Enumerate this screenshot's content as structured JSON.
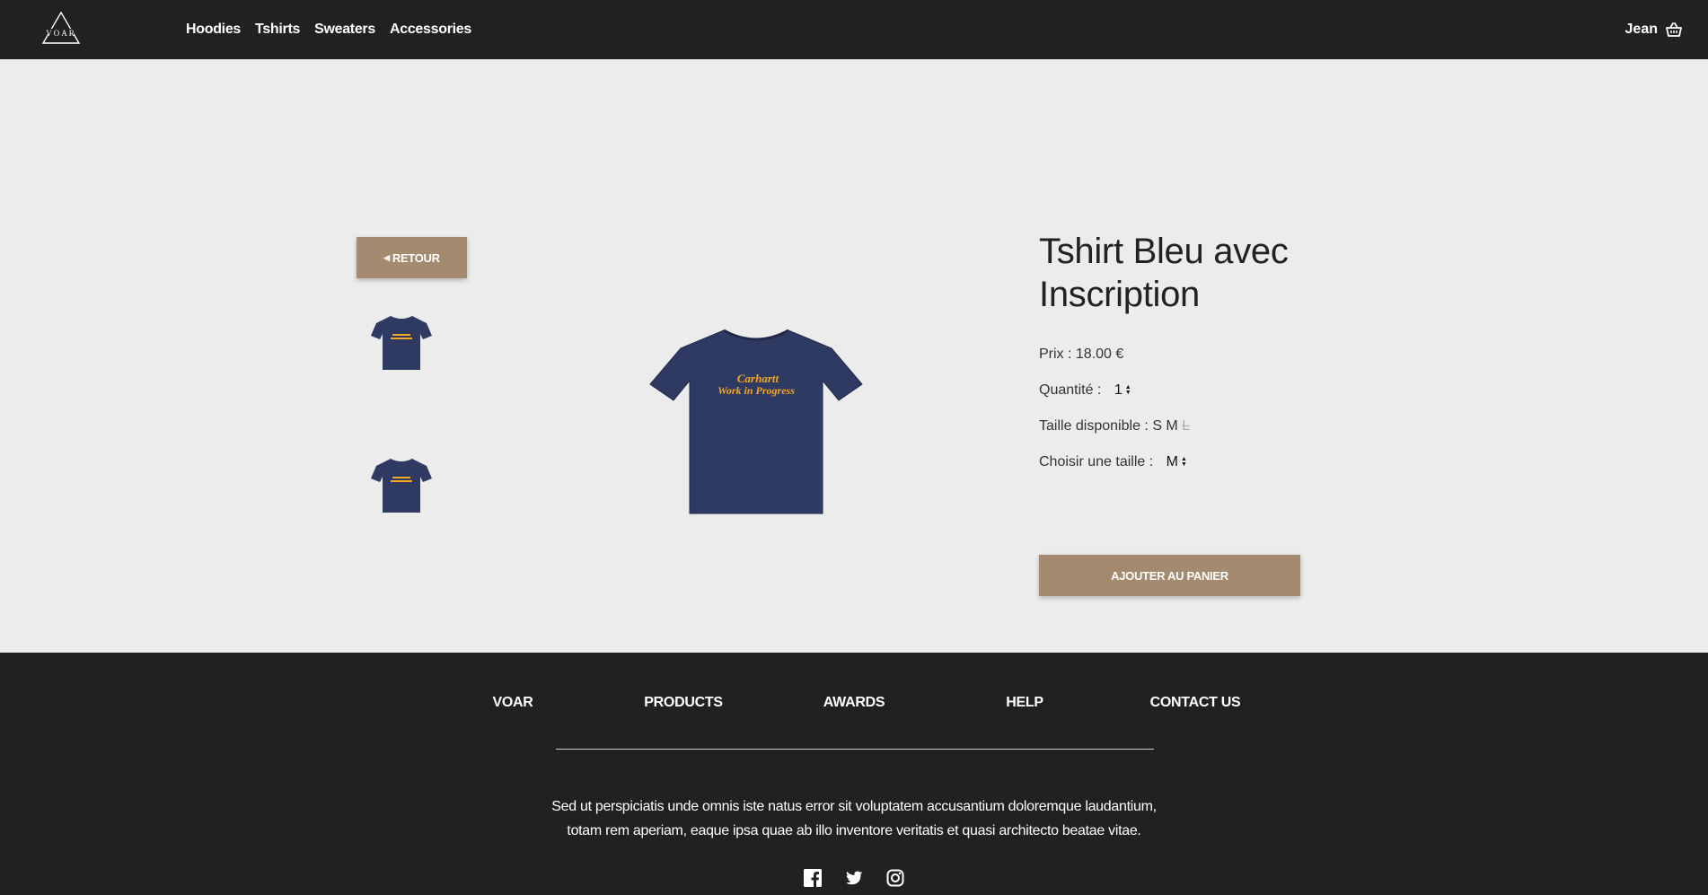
{
  "brand": {
    "logo_text": "VOAR"
  },
  "nav": {
    "links": [
      "Hoodies",
      "Tshirts",
      "Sweaters",
      "Accessories"
    ],
    "user": "Jean",
    "basket_icon": "basket-icon"
  },
  "product": {
    "back_label": "RETOUR",
    "title": "Tshirt Bleu avec Inscription",
    "price_label": "Prix : 18.00 €",
    "quantity_label": "Quantité :",
    "quantity_value": "1",
    "sizes_label": "Taille disponible :",
    "sizes_available": "S M",
    "size_unavailable": "L",
    "choose_size_label": "Choisir une taille :",
    "chosen_size": "M",
    "add_to_cart_label": "AJOUTER AU PANIER",
    "print_line_1": "Carhartt",
    "print_line_2": "Work in Progress",
    "shirt_color": "#2f3a63",
    "print_color": "#f5a623"
  },
  "footer": {
    "links": [
      "VOAR",
      "PRODUCTS",
      "AWARDS",
      "HELP",
      "CONTACT US"
    ],
    "text_line_1": "Sed ut perspiciatis unde omnis iste natus error sit voluptatem accusantium doloremque laudantium,",
    "text_line_2": "totam rem aperiam, eaque ipsa quae ab illo inventore veritatis et quasi architecto beatae vitae.",
    "social_icons": [
      "facebook-icon",
      "twitter-icon",
      "instagram-icon"
    ]
  },
  "colors": {
    "accent": "#a48b70",
    "dark": "#212121",
    "background": "#ececec"
  }
}
